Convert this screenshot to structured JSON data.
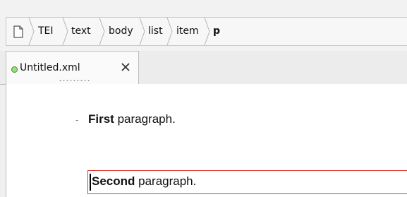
{
  "breadcrumb": {
    "root_icon": "document-icon",
    "items": [
      {
        "label": "TEI",
        "bold": false
      },
      {
        "label": "text",
        "bold": false
      },
      {
        "label": "body",
        "bold": false
      },
      {
        "label": "list",
        "bold": false
      },
      {
        "label": "item",
        "bold": false
      },
      {
        "label": "p",
        "bold": true
      }
    ]
  },
  "tabs": [
    {
      "title": "Untitled.xml",
      "status_icon": "modified-indicator-icon",
      "close_icon": "close-icon"
    }
  ],
  "editor": {
    "list_marker": "-",
    "paragraphs": [
      {
        "bold": "First",
        "rest": " paragraph."
      },
      {
        "bold": "Second",
        "rest": " paragraph."
      }
    ]
  },
  "colors": {
    "selection_border": "#e03a3a",
    "status_dot": "#9ede7c"
  }
}
